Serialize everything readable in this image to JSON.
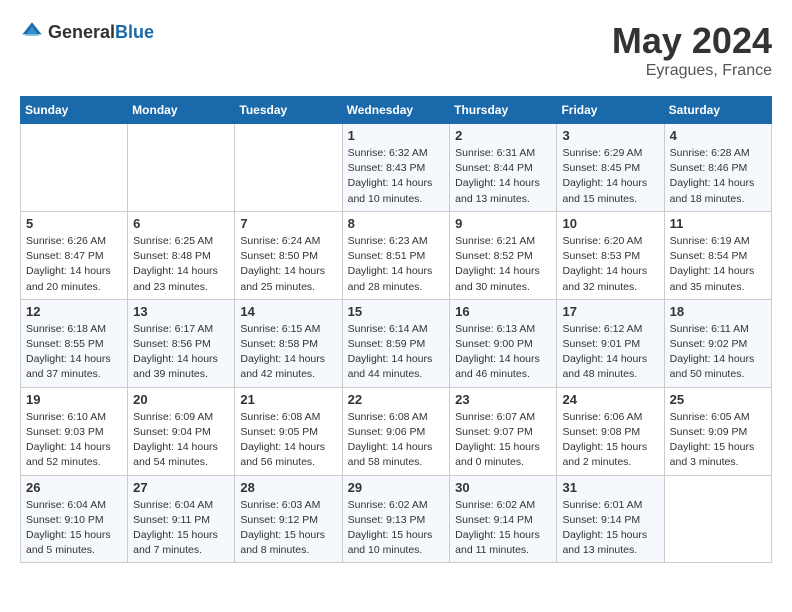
{
  "logo": {
    "general": "General",
    "blue": "Blue"
  },
  "title": {
    "month_year": "May 2024",
    "location": "Eyragues, France"
  },
  "weekdays": [
    "Sunday",
    "Monday",
    "Tuesday",
    "Wednesday",
    "Thursday",
    "Friday",
    "Saturday"
  ],
  "weeks": [
    [
      {
        "day": "",
        "info": ""
      },
      {
        "day": "",
        "info": ""
      },
      {
        "day": "",
        "info": ""
      },
      {
        "day": "1",
        "info": "Sunrise: 6:32 AM\nSunset: 8:43 PM\nDaylight: 14 hours\nand 10 minutes."
      },
      {
        "day": "2",
        "info": "Sunrise: 6:31 AM\nSunset: 8:44 PM\nDaylight: 14 hours\nand 13 minutes."
      },
      {
        "day": "3",
        "info": "Sunrise: 6:29 AM\nSunset: 8:45 PM\nDaylight: 14 hours\nand 15 minutes."
      },
      {
        "day": "4",
        "info": "Sunrise: 6:28 AM\nSunset: 8:46 PM\nDaylight: 14 hours\nand 18 minutes."
      }
    ],
    [
      {
        "day": "5",
        "info": "Sunrise: 6:26 AM\nSunset: 8:47 PM\nDaylight: 14 hours\nand 20 minutes."
      },
      {
        "day": "6",
        "info": "Sunrise: 6:25 AM\nSunset: 8:48 PM\nDaylight: 14 hours\nand 23 minutes."
      },
      {
        "day": "7",
        "info": "Sunrise: 6:24 AM\nSunset: 8:50 PM\nDaylight: 14 hours\nand 25 minutes."
      },
      {
        "day": "8",
        "info": "Sunrise: 6:23 AM\nSunset: 8:51 PM\nDaylight: 14 hours\nand 28 minutes."
      },
      {
        "day": "9",
        "info": "Sunrise: 6:21 AM\nSunset: 8:52 PM\nDaylight: 14 hours\nand 30 minutes."
      },
      {
        "day": "10",
        "info": "Sunrise: 6:20 AM\nSunset: 8:53 PM\nDaylight: 14 hours\nand 32 minutes."
      },
      {
        "day": "11",
        "info": "Sunrise: 6:19 AM\nSunset: 8:54 PM\nDaylight: 14 hours\nand 35 minutes."
      }
    ],
    [
      {
        "day": "12",
        "info": "Sunrise: 6:18 AM\nSunset: 8:55 PM\nDaylight: 14 hours\nand 37 minutes."
      },
      {
        "day": "13",
        "info": "Sunrise: 6:17 AM\nSunset: 8:56 PM\nDaylight: 14 hours\nand 39 minutes."
      },
      {
        "day": "14",
        "info": "Sunrise: 6:15 AM\nSunset: 8:58 PM\nDaylight: 14 hours\nand 42 minutes."
      },
      {
        "day": "15",
        "info": "Sunrise: 6:14 AM\nSunset: 8:59 PM\nDaylight: 14 hours\nand 44 minutes."
      },
      {
        "day": "16",
        "info": "Sunrise: 6:13 AM\nSunset: 9:00 PM\nDaylight: 14 hours\nand 46 minutes."
      },
      {
        "day": "17",
        "info": "Sunrise: 6:12 AM\nSunset: 9:01 PM\nDaylight: 14 hours\nand 48 minutes."
      },
      {
        "day": "18",
        "info": "Sunrise: 6:11 AM\nSunset: 9:02 PM\nDaylight: 14 hours\nand 50 minutes."
      }
    ],
    [
      {
        "day": "19",
        "info": "Sunrise: 6:10 AM\nSunset: 9:03 PM\nDaylight: 14 hours\nand 52 minutes."
      },
      {
        "day": "20",
        "info": "Sunrise: 6:09 AM\nSunset: 9:04 PM\nDaylight: 14 hours\nand 54 minutes."
      },
      {
        "day": "21",
        "info": "Sunrise: 6:08 AM\nSunset: 9:05 PM\nDaylight: 14 hours\nand 56 minutes."
      },
      {
        "day": "22",
        "info": "Sunrise: 6:08 AM\nSunset: 9:06 PM\nDaylight: 14 hours\nand 58 minutes."
      },
      {
        "day": "23",
        "info": "Sunrise: 6:07 AM\nSunset: 9:07 PM\nDaylight: 15 hours\nand 0 minutes."
      },
      {
        "day": "24",
        "info": "Sunrise: 6:06 AM\nSunset: 9:08 PM\nDaylight: 15 hours\nand 2 minutes."
      },
      {
        "day": "25",
        "info": "Sunrise: 6:05 AM\nSunset: 9:09 PM\nDaylight: 15 hours\nand 3 minutes."
      }
    ],
    [
      {
        "day": "26",
        "info": "Sunrise: 6:04 AM\nSunset: 9:10 PM\nDaylight: 15 hours\nand 5 minutes."
      },
      {
        "day": "27",
        "info": "Sunrise: 6:04 AM\nSunset: 9:11 PM\nDaylight: 15 hours\nand 7 minutes."
      },
      {
        "day": "28",
        "info": "Sunrise: 6:03 AM\nSunset: 9:12 PM\nDaylight: 15 hours\nand 8 minutes."
      },
      {
        "day": "29",
        "info": "Sunrise: 6:02 AM\nSunset: 9:13 PM\nDaylight: 15 hours\nand 10 minutes."
      },
      {
        "day": "30",
        "info": "Sunrise: 6:02 AM\nSunset: 9:14 PM\nDaylight: 15 hours\nand 11 minutes."
      },
      {
        "day": "31",
        "info": "Sunrise: 6:01 AM\nSunset: 9:14 PM\nDaylight: 15 hours\nand 13 minutes."
      },
      {
        "day": "",
        "info": ""
      }
    ]
  ]
}
